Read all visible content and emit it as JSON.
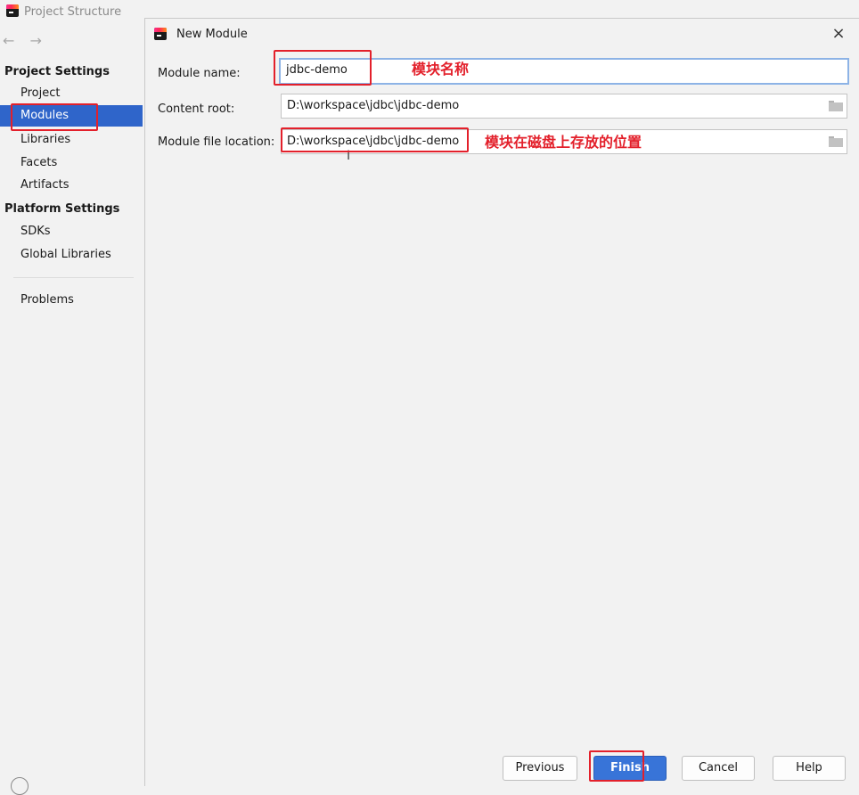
{
  "outer_window": {
    "title": "Project Structure",
    "nav_arrows": "← →"
  },
  "sidebar": {
    "project_settings_header": "Project Settings",
    "project_items": [
      {
        "label": "Project"
      },
      {
        "label": "Modules",
        "selected": true
      },
      {
        "label": "Libraries"
      },
      {
        "label": "Facets"
      },
      {
        "label": "Artifacts"
      }
    ],
    "platform_settings_header": "Platform Settings",
    "platform_items": [
      {
        "label": "SDKs"
      },
      {
        "label": "Global Libraries"
      }
    ],
    "problems_label": "Problems"
  },
  "dialog": {
    "title": "New Module",
    "close_icon": "×",
    "fields": {
      "module_name": {
        "label": "Module name:",
        "value": "jdbc-demo"
      },
      "content_root": {
        "label": "Content root:",
        "value": "D:\\workspace\\jdbc\\jdbc-demo"
      },
      "module_file_location": {
        "label": "Module file location:",
        "value": "D:\\workspace\\jdbc\\jdbc-demo"
      }
    },
    "annotations": {
      "module_name_note": "模块名称",
      "location_note": "模块在磁盘上存放的位置"
    },
    "buttons": {
      "previous": "Previous",
      "finish": "Finish",
      "cancel": "Cancel",
      "help": "Help"
    }
  },
  "colors": {
    "selection": "#2f65ca",
    "annotation_red": "#e3202b",
    "primary_button": "#3874d8"
  }
}
